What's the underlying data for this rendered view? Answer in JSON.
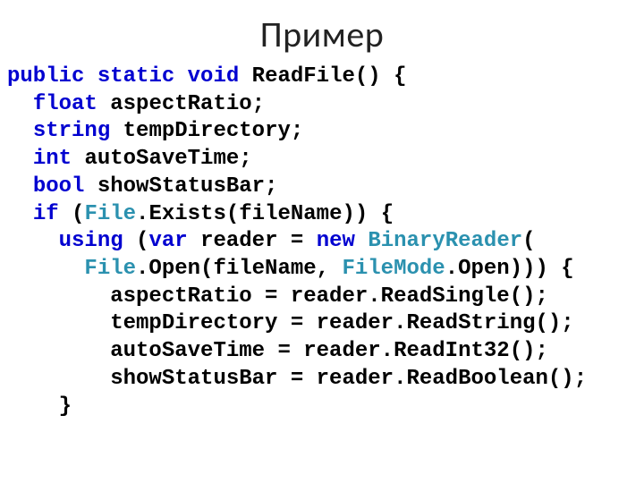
{
  "title": "Пример",
  "c": {
    "l1": {
      "t1": "public",
      "t2": "static",
      "t3": "void",
      "t4": "ReadFile() {"
    },
    "l2": {
      "t1": "float",
      "t2": "aspectRatio;"
    },
    "l3": {
      "t1": "string",
      "t2": "tempDirectory;"
    },
    "l4": {
      "t1": "int",
      "t2": "autoSaveTime;"
    },
    "l5": {
      "t1": "bool",
      "t2": "showStatusBar;"
    },
    "l6": {
      "t1": "if",
      "t2": "(",
      "t3": "File",
      "t4": ".Exists(fileName)) {"
    },
    "l7": {
      "t1": "using",
      "t2": "(",
      "t3": "var",
      "t4": "reader =",
      "t5": "new",
      "t6": "BinaryReader",
      "t7": "("
    },
    "l8": {
      "t1": "File",
      "t2": ".Open(fileName, ",
      "t3": "FileMode",
      "t4": ".Open))) {"
    },
    "l9": "aspectRatio = reader.ReadSingle();",
    "l10": "tempDirectory = reader.ReadString();",
    "l11": "autoSaveTime = reader.ReadInt32();",
    "l12": "showStatusBar = reader.ReadBoolean();",
    "l13": "}"
  }
}
